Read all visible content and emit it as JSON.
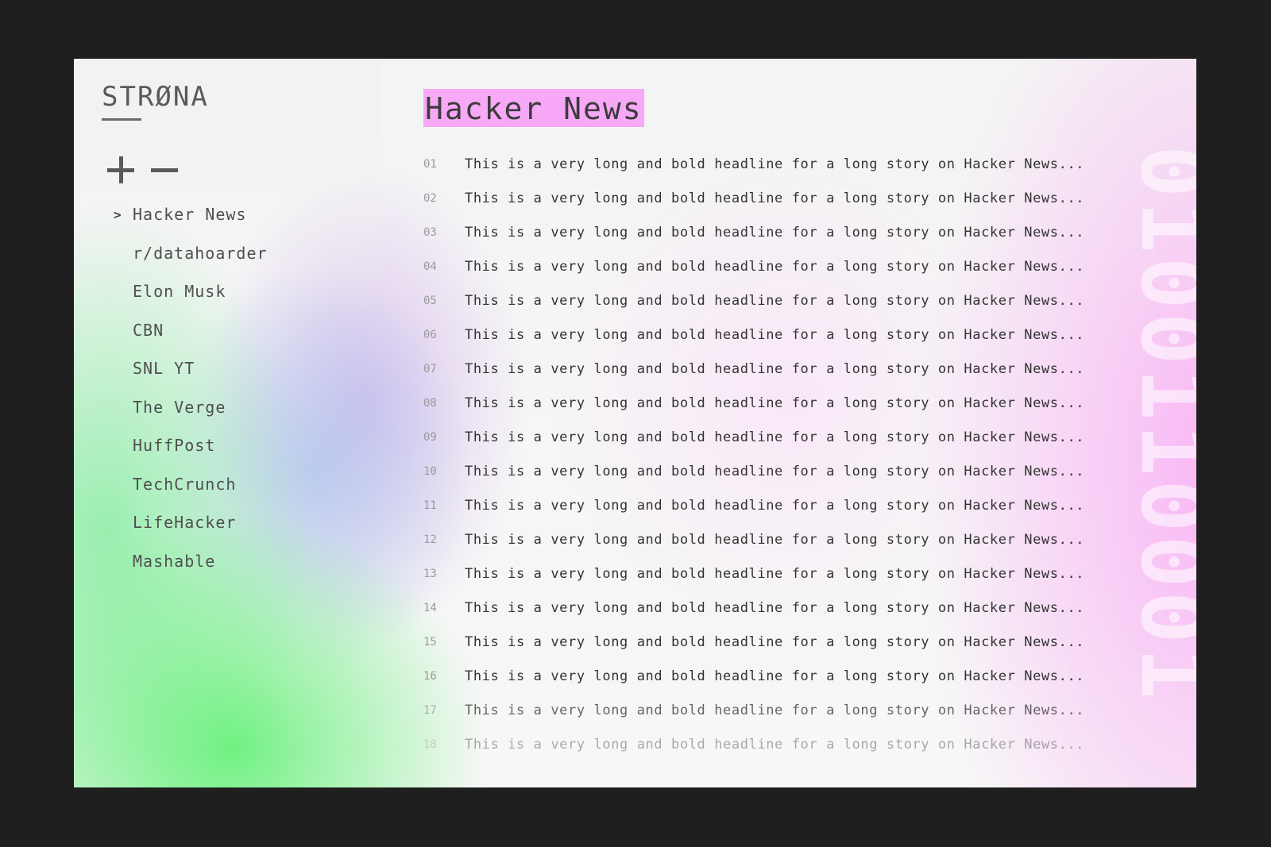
{
  "app": {
    "logo": "STRØNA"
  },
  "sidebar": {
    "controls": {
      "add_icon": "plus-icon",
      "remove_icon": "minus-icon"
    },
    "items": [
      {
        "label": "Hacker News",
        "active": true
      },
      {
        "label": "r/datahoarder",
        "active": false
      },
      {
        "label": "Elon Musk",
        "active": false
      },
      {
        "label": "CBN",
        "active": false
      },
      {
        "label": "SNL YT",
        "active": false
      },
      {
        "label": "The Verge",
        "active": false
      },
      {
        "label": "HuffPost",
        "active": false
      },
      {
        "label": "TechCrunch",
        "active": false
      },
      {
        "label": "LifeHacker",
        "active": false
      },
      {
        "label": "Mashable",
        "active": false
      }
    ]
  },
  "main": {
    "title": "Hacker News",
    "stories": [
      {
        "num": "01",
        "text": "This is a  very long and bold headline for a long story on Hacker News..."
      },
      {
        "num": "02",
        "text": "This is a  very long and bold headline for a long story on Hacker News..."
      },
      {
        "num": "03",
        "text": "This is a  very long and bold headline for a long story on Hacker News..."
      },
      {
        "num": "04",
        "text": "This is a  very long and bold headline for a long story on Hacker News..."
      },
      {
        "num": "05",
        "text": "This is a  very long and bold headline for a long story on Hacker News..."
      },
      {
        "num": "06",
        "text": "This is a  very long and bold headline for a long story on Hacker News..."
      },
      {
        "num": "07",
        "text": "This is a  very long and bold headline for a long story on Hacker News..."
      },
      {
        "num": "08",
        "text": "This is a  very long and bold headline for a long story on Hacker News..."
      },
      {
        "num": "09",
        "text": "This is a  very long and bold headline for a long story on Hacker News..."
      },
      {
        "num": "10",
        "text": "This is a  very long and bold headline for a long story on Hacker News..."
      },
      {
        "num": "11",
        "text": "This is a  very long and bold headline for a long story on Hacker News..."
      },
      {
        "num": "12",
        "text": "This is a  very long and bold headline for a long story on Hacker News..."
      },
      {
        "num": "13",
        "text": "This is a  very long and bold headline for a long story on Hacker News..."
      },
      {
        "num": "14",
        "text": "This is a  very long and bold headline for a long story on Hacker News..."
      },
      {
        "num": "15",
        "text": "This is a  very long and bold headline for a long story on Hacker News..."
      },
      {
        "num": "16",
        "text": "This is a  very long and bold headline for a long story on Hacker News..."
      },
      {
        "num": "17",
        "text": "This is a  very long and bold headline for a long story on Hacker News..."
      },
      {
        "num": "18",
        "text": "This is a  very long and bold headline for a long story on Hacker News..."
      }
    ]
  },
  "colors": {
    "title_highlight": "#f7a8f7",
    "text": "#333333",
    "number": "#9a9a9a",
    "outer_background": "#1f1f1f"
  }
}
